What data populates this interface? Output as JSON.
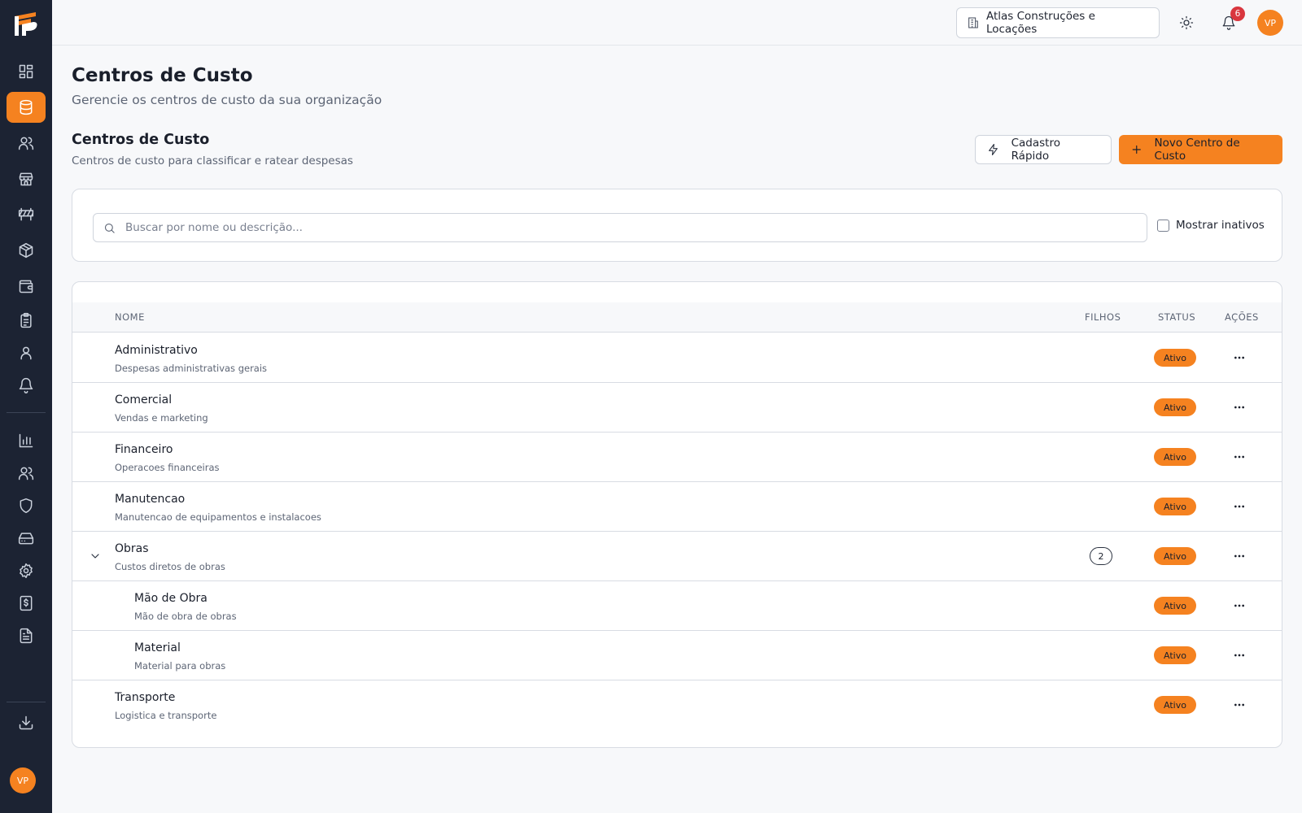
{
  "sidebar": {
    "items": [
      {
        "name": "dashboard",
        "icon": "grid-icon"
      },
      {
        "name": "cost-centers",
        "icon": "database-icon",
        "active": true
      },
      {
        "name": "users",
        "icon": "users-icon"
      },
      {
        "name": "store",
        "icon": "store-icon"
      },
      {
        "name": "construction",
        "icon": "barrier-icon"
      },
      {
        "name": "products",
        "icon": "package-icon"
      },
      {
        "name": "wallet",
        "icon": "wallet-icon"
      },
      {
        "name": "tasks",
        "icon": "clipboard-icon"
      },
      {
        "name": "profile",
        "icon": "user-icon"
      },
      {
        "name": "notifications",
        "icon": "bell-icon"
      },
      {
        "name": "reports",
        "icon": "bar-chart-icon"
      },
      {
        "name": "team",
        "icon": "users-icon"
      },
      {
        "name": "security",
        "icon": "shield-icon"
      },
      {
        "name": "storage",
        "icon": "hard-drive-icon"
      },
      {
        "name": "settings",
        "icon": "gear-icon"
      },
      {
        "name": "billing",
        "icon": "receipt-dollar-icon"
      },
      {
        "name": "documents",
        "icon": "document-icon"
      },
      {
        "name": "download",
        "icon": "download-icon"
      }
    ],
    "avatar_initials": "VP",
    "accent_color": "#f58220",
    "background_color": "#1c2333"
  },
  "topbar": {
    "organization": "Atlas Construções e Locações",
    "notification_count": "6",
    "avatar_initials": "VP"
  },
  "page": {
    "title": "Centros de Custo",
    "subtitle": "Gerencie os centros de custo da sua organização"
  },
  "section": {
    "title": "Centros de Custo",
    "subtitle": "Centros de custo para classificar e ratear despesas",
    "quick_button": "Cadastro Rápido",
    "new_button": "Novo Centro de Custo"
  },
  "filters": {
    "search_placeholder": "Buscar por nome ou descrição...",
    "show_inactive_label": "Mostrar inativos",
    "show_inactive_checked": false
  },
  "table": {
    "columns": {
      "name": "NOME",
      "children": "FILHOS",
      "status": "STATUS",
      "actions": "AÇÕES"
    },
    "rows": [
      {
        "name": "Administrativo",
        "description": "Despesas administrativas gerais",
        "children": "",
        "status": "Ativo",
        "level": 0
      },
      {
        "name": "Comercial",
        "description": "Vendas e marketing",
        "children": "",
        "status": "Ativo",
        "level": 0
      },
      {
        "name": "Financeiro",
        "description": "Operacoes financeiras",
        "children": "",
        "status": "Ativo",
        "level": 0
      },
      {
        "name": "Manutencao",
        "description": "Manutencao de equipamentos e instalacoes",
        "children": "",
        "status": "Ativo",
        "level": 0
      },
      {
        "name": "Obras",
        "description": "Custos diretos de obras",
        "children": "2",
        "status": "Ativo",
        "level": 0,
        "expanded": true
      },
      {
        "name": "Mão de Obra",
        "description": "Mão de obra de obras",
        "children": "",
        "status": "Ativo",
        "level": 1
      },
      {
        "name": "Material",
        "description": "Material para obras",
        "children": "",
        "status": "Ativo",
        "level": 1
      },
      {
        "name": "Transporte",
        "description": "Logistica e transporte",
        "children": "",
        "status": "Ativo",
        "level": 0
      }
    ]
  }
}
